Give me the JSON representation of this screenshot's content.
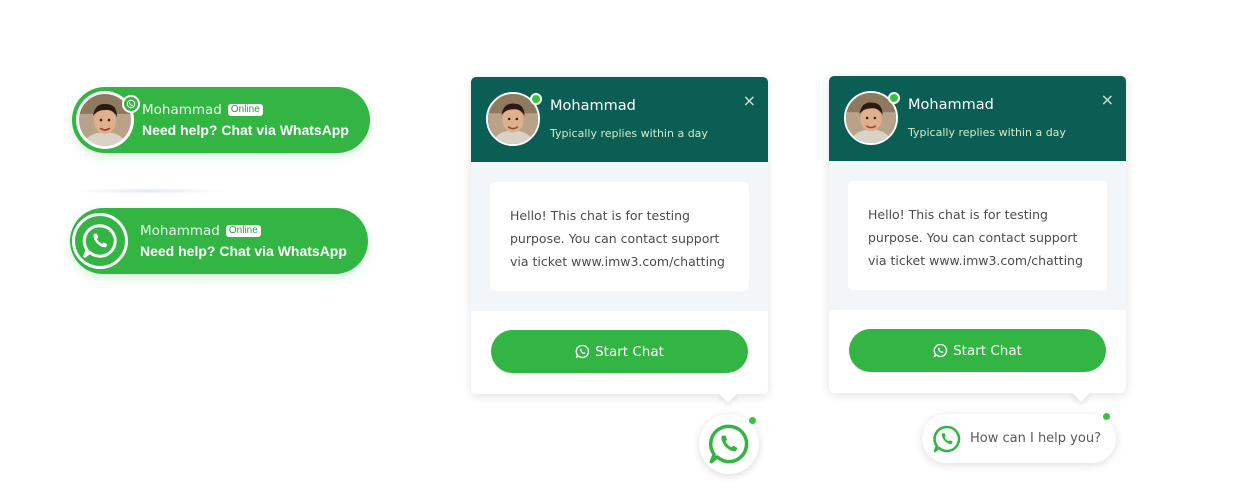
{
  "colors": {
    "brand_green": "#33b544",
    "header_teal": "#0a5e54",
    "online_dot": "#35c33e"
  },
  "icons": {
    "whatsapp": "whatsapp-icon",
    "close": "close-icon",
    "avatar": "agent-avatar"
  },
  "pill_buttons": [
    {
      "name": "Mohammad",
      "status": "Online",
      "cta": "Need help? Chat via WhatsApp",
      "variant": "avatar"
    },
    {
      "name": "Mohammad",
      "status": "Online",
      "cta": "Need help? Chat via WhatsApp",
      "variant": "whatsapp-icon"
    }
  ],
  "chat_cards": [
    {
      "agent_name": "Mohammad",
      "reply_time": "Typically replies within a day",
      "close_symbol": "×",
      "message": "Hello! This chat is for testing purpose. You can contact support via ticket www.imw3.com/chatting",
      "button_label": "Start Chat"
    },
    {
      "agent_name": "Mohammad",
      "reply_time": "Typically replies within a day",
      "close_symbol": "×",
      "message": "Hello! This chat is for testing purpose. You can contact support via ticket www.imw3.com/chatting",
      "button_label": "Start Chat"
    }
  ],
  "help_launcher": {
    "label": "How can I help you?"
  }
}
